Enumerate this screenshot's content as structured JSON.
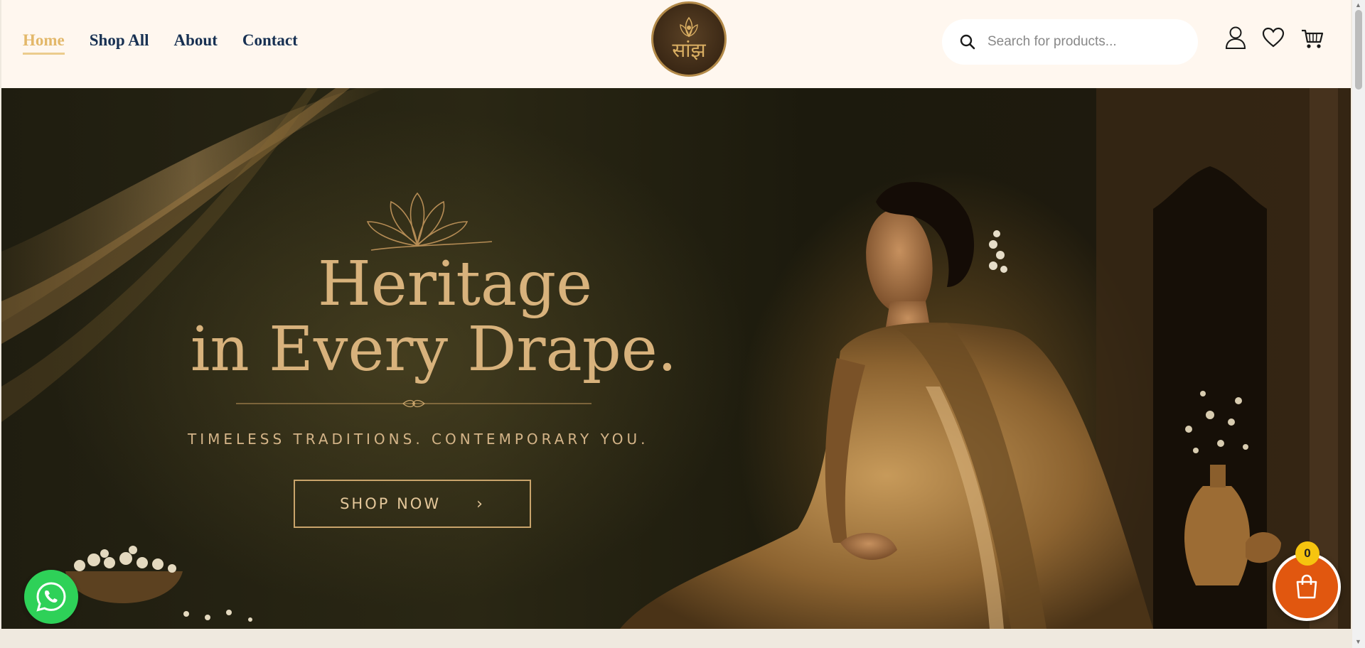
{
  "nav": {
    "items": [
      {
        "label": "Home",
        "active": true
      },
      {
        "label": "Shop All",
        "active": false
      },
      {
        "label": "About",
        "active": false
      },
      {
        "label": "Contact",
        "active": false
      }
    ]
  },
  "logo": {
    "text": "सांझ"
  },
  "search": {
    "placeholder": "Search for products...",
    "icon": "search-icon"
  },
  "header_icons": [
    "user-icon",
    "heart-icon",
    "cart-icon"
  ],
  "hero": {
    "title_line1": "Heritage",
    "title_line2": "in Every Drape.",
    "tagline": "TIMELESS TRADITIONS. CONTEMPORARY YOU.",
    "cta_label": "SHOP NOW"
  },
  "floating": {
    "whatsapp_icon": "whatsapp-icon",
    "cart_count": "0",
    "cart_icon": "shopping-bag-icon"
  },
  "colors": {
    "nav_text": "#173052",
    "nav_active": "#e3b86a",
    "header_bg": "#fff7ef",
    "hero_gold": "#d8b27c",
    "cart_fab": "#e1570f",
    "badge": "#f6c40f",
    "whatsapp": "#2ed158"
  }
}
